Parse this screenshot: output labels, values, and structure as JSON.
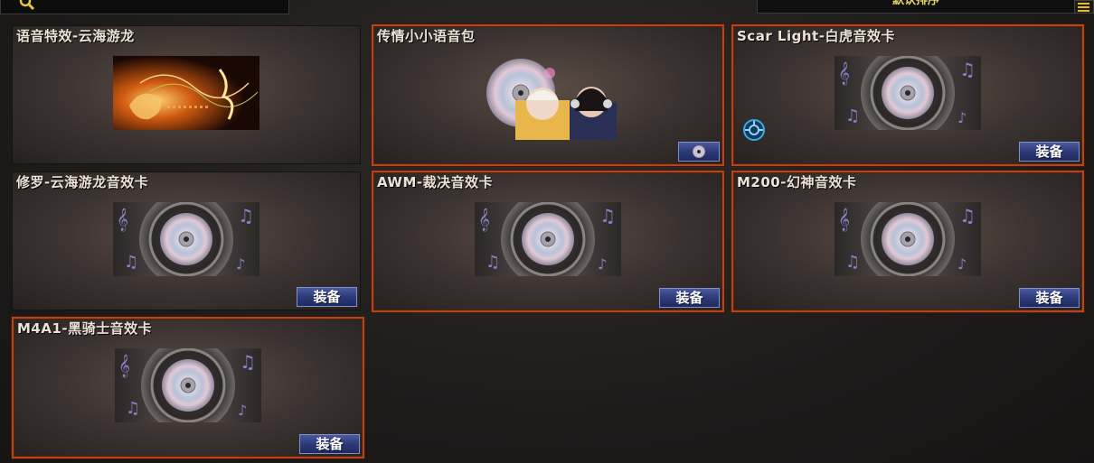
{
  "toolbar": {
    "search_icon": "search-icon",
    "sort_label": "默认排序",
    "menu_icon": "menu-icon"
  },
  "colors": {
    "selected_border": "#b3461d",
    "equip_button": "#2d3a78",
    "sort_text": "#e6d76a"
  },
  "items": [
    {
      "title": "语音特效-云海游龙",
      "art": "dragon-sound-effect-art",
      "button": ""
    },
    {
      "title": "传情小小语音包",
      "art": "voice-pack-cd-characters-art",
      "button": "cd-icon"
    },
    {
      "title": "Scar Light-白虎音效卡",
      "art": "sound-card-speaker-art",
      "button": "装备",
      "badge": "target-badge-icon"
    },
    {
      "title": "修罗-云海游龙音效卡",
      "art": "sound-card-speaker-art",
      "button": "装备"
    },
    {
      "title": "AWM-裁决音效卡",
      "art": "sound-card-speaker-art",
      "button": "装备"
    },
    {
      "title": "M200-幻神音效卡",
      "art": "sound-card-speaker-art",
      "button": "装备"
    },
    {
      "title": "M4A1-黑骑士音效卡",
      "art": "sound-card-speaker-art",
      "button": "装备"
    }
  ]
}
